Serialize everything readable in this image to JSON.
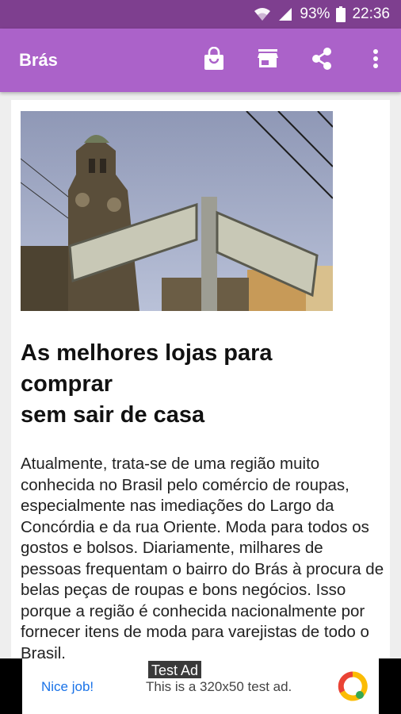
{
  "status_bar": {
    "battery": "93%",
    "time": "22:36",
    "icons": [
      "wifi-icon",
      "signal-icon",
      "battery-icon"
    ]
  },
  "app_bar": {
    "title": "Brás",
    "actions": [
      "shopping-bag-icon",
      "store-icon",
      "share-icon",
      "more-vert-icon"
    ],
    "color": "#ab62c9"
  },
  "article": {
    "image_description": "Largo Brás street signs",
    "headline": "As melhores lojas para comprar\nsem sair de casa",
    "body": "Atualmente, trata-se de uma região muito conhecida no Brasil pelo comércio de roupas, especialmente nas imediações do Largo da Concórdia e da rua Oriente. Moda para todos os gostos e bolsos. Diariamente, milhares de pessoas frequentam o bairro do Brás à procura de belas peças de roupas e bons negócios. Isso porque a região é conhecida nacionalmente por fornecer itens de moda para varejistas de todo o Brasil."
  },
  "ad": {
    "label": "Test Ad",
    "nice": "Nice job!",
    "text": "This is a 320x50 test ad."
  }
}
